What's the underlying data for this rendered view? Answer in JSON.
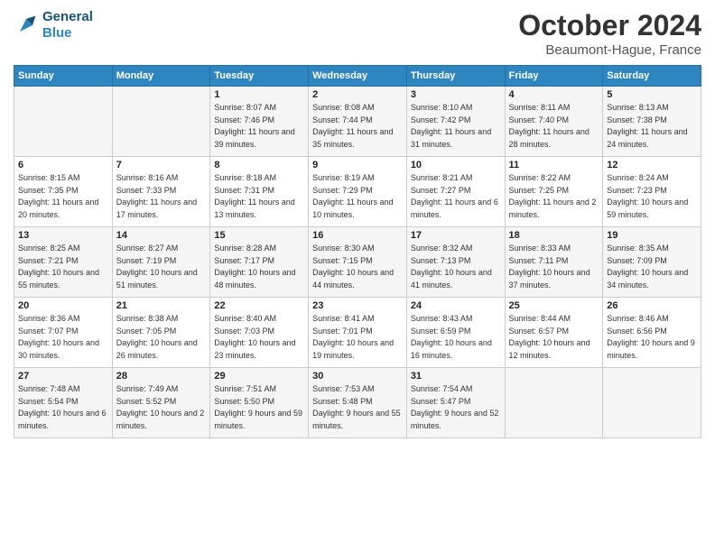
{
  "header": {
    "logo_line1": "General",
    "logo_line2": "Blue",
    "month_title": "October 2024",
    "location": "Beaumont-Hague, France"
  },
  "weekdays": [
    "Sunday",
    "Monday",
    "Tuesday",
    "Wednesday",
    "Thursday",
    "Friday",
    "Saturday"
  ],
  "weeks": [
    [
      {
        "day": "",
        "sunrise": "",
        "sunset": "",
        "daylight": ""
      },
      {
        "day": "",
        "sunrise": "",
        "sunset": "",
        "daylight": ""
      },
      {
        "day": "1",
        "sunrise": "Sunrise: 8:07 AM",
        "sunset": "Sunset: 7:46 PM",
        "daylight": "Daylight: 11 hours and 39 minutes."
      },
      {
        "day": "2",
        "sunrise": "Sunrise: 8:08 AM",
        "sunset": "Sunset: 7:44 PM",
        "daylight": "Daylight: 11 hours and 35 minutes."
      },
      {
        "day": "3",
        "sunrise": "Sunrise: 8:10 AM",
        "sunset": "Sunset: 7:42 PM",
        "daylight": "Daylight: 11 hours and 31 minutes."
      },
      {
        "day": "4",
        "sunrise": "Sunrise: 8:11 AM",
        "sunset": "Sunset: 7:40 PM",
        "daylight": "Daylight: 11 hours and 28 minutes."
      },
      {
        "day": "5",
        "sunrise": "Sunrise: 8:13 AM",
        "sunset": "Sunset: 7:38 PM",
        "daylight": "Daylight: 11 hours and 24 minutes."
      }
    ],
    [
      {
        "day": "6",
        "sunrise": "Sunrise: 8:15 AM",
        "sunset": "Sunset: 7:35 PM",
        "daylight": "Daylight: 11 hours and 20 minutes."
      },
      {
        "day": "7",
        "sunrise": "Sunrise: 8:16 AM",
        "sunset": "Sunset: 7:33 PM",
        "daylight": "Daylight: 11 hours and 17 minutes."
      },
      {
        "day": "8",
        "sunrise": "Sunrise: 8:18 AM",
        "sunset": "Sunset: 7:31 PM",
        "daylight": "Daylight: 11 hours and 13 minutes."
      },
      {
        "day": "9",
        "sunrise": "Sunrise: 8:19 AM",
        "sunset": "Sunset: 7:29 PM",
        "daylight": "Daylight: 11 hours and 10 minutes."
      },
      {
        "day": "10",
        "sunrise": "Sunrise: 8:21 AM",
        "sunset": "Sunset: 7:27 PM",
        "daylight": "Daylight: 11 hours and 6 minutes."
      },
      {
        "day": "11",
        "sunrise": "Sunrise: 8:22 AM",
        "sunset": "Sunset: 7:25 PM",
        "daylight": "Daylight: 11 hours and 2 minutes."
      },
      {
        "day": "12",
        "sunrise": "Sunrise: 8:24 AM",
        "sunset": "Sunset: 7:23 PM",
        "daylight": "Daylight: 10 hours and 59 minutes."
      }
    ],
    [
      {
        "day": "13",
        "sunrise": "Sunrise: 8:25 AM",
        "sunset": "Sunset: 7:21 PM",
        "daylight": "Daylight: 10 hours and 55 minutes."
      },
      {
        "day": "14",
        "sunrise": "Sunrise: 8:27 AM",
        "sunset": "Sunset: 7:19 PM",
        "daylight": "Daylight: 10 hours and 51 minutes."
      },
      {
        "day": "15",
        "sunrise": "Sunrise: 8:28 AM",
        "sunset": "Sunset: 7:17 PM",
        "daylight": "Daylight: 10 hours and 48 minutes."
      },
      {
        "day": "16",
        "sunrise": "Sunrise: 8:30 AM",
        "sunset": "Sunset: 7:15 PM",
        "daylight": "Daylight: 10 hours and 44 minutes."
      },
      {
        "day": "17",
        "sunrise": "Sunrise: 8:32 AM",
        "sunset": "Sunset: 7:13 PM",
        "daylight": "Daylight: 10 hours and 41 minutes."
      },
      {
        "day": "18",
        "sunrise": "Sunrise: 8:33 AM",
        "sunset": "Sunset: 7:11 PM",
        "daylight": "Daylight: 10 hours and 37 minutes."
      },
      {
        "day": "19",
        "sunrise": "Sunrise: 8:35 AM",
        "sunset": "Sunset: 7:09 PM",
        "daylight": "Daylight: 10 hours and 34 minutes."
      }
    ],
    [
      {
        "day": "20",
        "sunrise": "Sunrise: 8:36 AM",
        "sunset": "Sunset: 7:07 PM",
        "daylight": "Daylight: 10 hours and 30 minutes."
      },
      {
        "day": "21",
        "sunrise": "Sunrise: 8:38 AM",
        "sunset": "Sunset: 7:05 PM",
        "daylight": "Daylight: 10 hours and 26 minutes."
      },
      {
        "day": "22",
        "sunrise": "Sunrise: 8:40 AM",
        "sunset": "Sunset: 7:03 PM",
        "daylight": "Daylight: 10 hours and 23 minutes."
      },
      {
        "day": "23",
        "sunrise": "Sunrise: 8:41 AM",
        "sunset": "Sunset: 7:01 PM",
        "daylight": "Daylight: 10 hours and 19 minutes."
      },
      {
        "day": "24",
        "sunrise": "Sunrise: 8:43 AM",
        "sunset": "Sunset: 6:59 PM",
        "daylight": "Daylight: 10 hours and 16 minutes."
      },
      {
        "day": "25",
        "sunrise": "Sunrise: 8:44 AM",
        "sunset": "Sunset: 6:57 PM",
        "daylight": "Daylight: 10 hours and 12 minutes."
      },
      {
        "day": "26",
        "sunrise": "Sunrise: 8:46 AM",
        "sunset": "Sunset: 6:56 PM",
        "daylight": "Daylight: 10 hours and 9 minutes."
      }
    ],
    [
      {
        "day": "27",
        "sunrise": "Sunrise: 7:48 AM",
        "sunset": "Sunset: 5:54 PM",
        "daylight": "Daylight: 10 hours and 6 minutes."
      },
      {
        "day": "28",
        "sunrise": "Sunrise: 7:49 AM",
        "sunset": "Sunset: 5:52 PM",
        "daylight": "Daylight: 10 hours and 2 minutes."
      },
      {
        "day": "29",
        "sunrise": "Sunrise: 7:51 AM",
        "sunset": "Sunset: 5:50 PM",
        "daylight": "Daylight: 9 hours and 59 minutes."
      },
      {
        "day": "30",
        "sunrise": "Sunrise: 7:53 AM",
        "sunset": "Sunset: 5:48 PM",
        "daylight": "Daylight: 9 hours and 55 minutes."
      },
      {
        "day": "31",
        "sunrise": "Sunrise: 7:54 AM",
        "sunset": "Sunset: 5:47 PM",
        "daylight": "Daylight: 9 hours and 52 minutes."
      },
      {
        "day": "",
        "sunrise": "",
        "sunset": "",
        "daylight": ""
      },
      {
        "day": "",
        "sunrise": "",
        "sunset": "",
        "daylight": ""
      }
    ]
  ]
}
